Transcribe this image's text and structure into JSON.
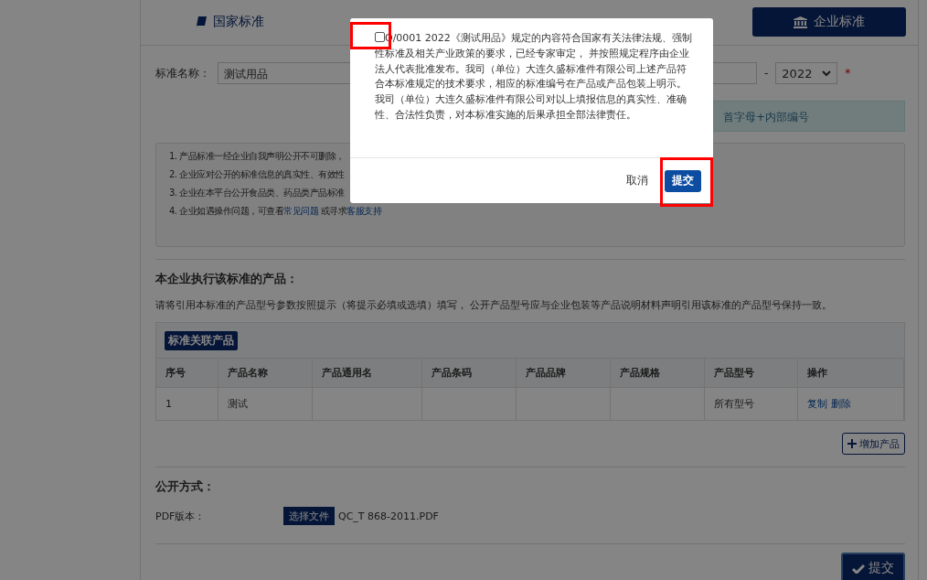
{
  "tabs": [
    {
      "label": "国家标准",
      "selected": false
    },
    {
      "label": "企业标准",
      "selected": true
    }
  ],
  "form": {
    "name_label": "标准名称：",
    "name_value": "测试用品",
    "separator": "-",
    "year": "2022",
    "required_mark": "*",
    "hint": "首字母+内部编号"
  },
  "notes": [
    {
      "text": "1. 产品标准一经企业自我声明公开不可删除，"
    },
    {
      "text": "2. 企业应对公开的标准信息的真实性、有效性"
    },
    {
      "text": "3. 企业在本平台公开食品类、药品类产品标准"
    },
    {
      "text": "4. 企业如遇操作问题，可查看",
      "link1": "常见问题",
      "middle": " 或寻求",
      "link2": "客服支持"
    }
  ],
  "products": {
    "heading": "本企业执行该标准的产品：",
    "description": "请将引用本标准的产品型号参数按照提示（将提示必填或选填）填写， 公开产品型号应与企业包装等产品说明材料声明引用该标准的产品型号保持一致。",
    "badge": "标准关联产品",
    "columns": [
      "序号",
      "产品名称",
      "产品通用名",
      "产品条码",
      "产品品牌",
      "产品规格",
      "产品型号",
      "操作"
    ],
    "rows": [
      {
        "cells": [
          "1",
          "测试",
          "",
          "",
          "",
          "",
          "所有型号"
        ],
        "actions": [
          "复制",
          "删除"
        ]
      }
    ],
    "add_button": "增加产品"
  },
  "publish": {
    "heading": "公开方式：",
    "pdf_label": "PDF版本：",
    "choose_button": "选择文件",
    "file_name": "QC_T 868-2011.PDF"
  },
  "submit_button": "提交",
  "modal": {
    "checked": false,
    "text": "Q/0001 2022《测试用品》规定的内容符合国家有关法律法规、强制性标准及相关产业政策的要求，已经专家审定， 并按照规定程序由企业法人代表批准发布。我司（单位）大连久盛标准件有限公司上述产品符合本标准规定的技术要求，相应的标准编号在产品或产品包装上明示。我司（单位）大连久盛标准件有限公司对以上填报信息的真实性、准确性、合法性负责，对本标准实施的后果承担全部法律责任。",
    "cancel": "取消",
    "confirm": "提交"
  }
}
